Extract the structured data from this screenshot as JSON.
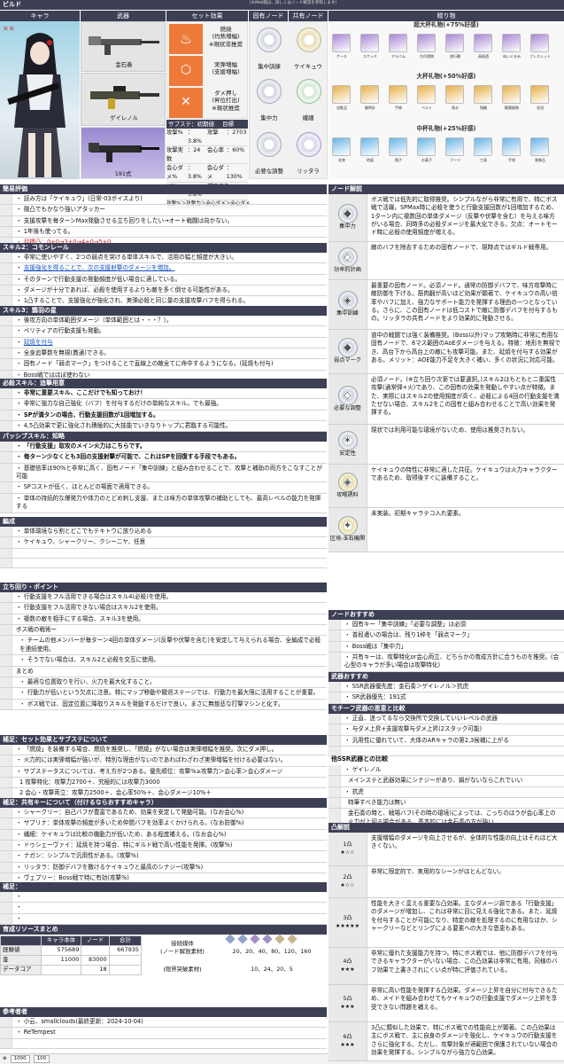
{
  "title_bar": "ビルド",
  "note_top": "(※Web版は、詳しくはノード解説を参照します)",
  "headers": {
    "chara": "キャラ",
    "weapon": "武器",
    "set": "セット効果",
    "fixed_node": "固有ノード",
    "shared_node": "共有ノード",
    "gifts": "贈り物"
  },
  "weapons": [
    {
      "name": "金石奏"
    },
    {
      "name": "ゲイレノル"
    },
    {
      "name": "191式"
    }
  ],
  "sets": [
    {
      "name": "燃焼",
      "sub": "(灼熱増幅)",
      "note": "※現状非推奨"
    },
    {
      "name": "実弾増幅",
      "sub": "(支援増幅)"
    },
    {
      "name": "ダメ押し",
      "sub": "(昇位打出)",
      "note": "※現状推奨"
    }
  ],
  "substats": {
    "title": "サブステ：初期値",
    "target": "目標",
    "rows": [
      [
        "攻撃%",
        "：3.8%",
        "攻撃",
        "：2703"
      ],
      [
        "攻撃実数",
        "：24",
        "会心率",
        "：60%"
      ],
      [
        "会心ダメ%",
        "：3.8%",
        "会心ダメ",
        "：130%"
      ],
      [
        "HP%",
        "：3.8%",
        "補足あり",
        ""
      ]
    ],
    "priority": "攻撃%＞攻撃力＞会心ダメ＞会心ダメ"
  },
  "nodes_top": [
    {
      "left": "集中訓練",
      "right": "ケイキュウ"
    },
    {
      "left": "集中力",
      "right": "繊細"
    },
    {
      "left": "必要な調整",
      "right": "リッタラ"
    }
  ],
  "gifts": {
    "super": "超大杯礼物(+75%好感)",
    "big": "大杯礼物(+50%好感)",
    "mid": "中杯礼物(+25%好感)",
    "super_items": [
      "ケーキ",
      "スケッチ",
      "アルバム",
      "古代遺物",
      "旅行鞄",
      "高級酒",
      "ぬいぐるみ",
      "ブレスレット"
    ],
    "big_items": [
      "化粧品",
      "腕時計",
      "手帳",
      "ベルト",
      "香水",
      "指輪",
      "観葉植物",
      "花冠"
    ],
    "mid_items": [
      "花束",
      "地図",
      "帽子",
      "お菓子",
      "ブーツ",
      "工具",
      "手袋",
      "装飾品"
    ]
  },
  "eval": {
    "title": "簡易評価",
    "lines": [
      "読み方は「ケイキュウ」(日常-03ボイスより)",
      "微凸でもかなり強いアタッカー",
      "支援攻撃を毎ターンMax発動させる立ち回りをしたい→オート戦闘は向かない。",
      "1年後も使ってる。",
      "目標凸：0+0→3+0→4+0→5+0"
    ]
  },
  "skill2": {
    "title": "スキル2：コモンレール",
    "lines": [
      "非常に使いやすく、2つの弱点を突ける単体スキルで、活用の幅と頻度が大きい。",
      "支援強化を得ることで、次の支援射撃のダメージを増加。",
      "そのターンで行動支援の発動頻度が低い場合に適している。",
      "ダメージが十分であれば、必殺を使用するよりも敵を多く倒せる可能性がある。",
      "1凸することで、支援強化が強化され、実弾必殺と同じ量の支援攻撃バフを得られる。"
    ]
  },
  "skill3": {
    "title": "スキル3：鵲羽の星",
    "lines": [
      "後攻方向の単体範囲ダメージ（単体範囲とは・・・？）。",
      "ベリティアの行動支援も発動。",
      "延焼を付与",
      "全身追撃数を無視(貫通)できる。",
      "固有ノード「弱点マーク」をつけることで直線上の敵全てに命中するようになる。(延焼も付与)",
      "Boss戦ではほぼ使わない"
    ]
  },
  "ult": {
    "title": "必殺スキル：追撃用意",
    "lines": [
      "非常に重要スキル、ここだけでも知っておけ！",
      "非常に強力な自己強化（バフ）を付与するだけの単純なスキル。でも最強。",
      "SPが満タンの場合、行動支援回数が1回増加する。",
      "4,5凸効果で更に強化され積極的に大技能でいきなりトップに君臨する可能性。"
    ]
  },
  "passive": {
    "title": "パッシブスキル：知略",
    "lines": [
      "「行動支援」取攻のメイン火力はこちらです。",
      "毎ターン少なくとも3回の支援射撃が可能で、これはSPを回復する手段でもある。",
      "基礎倍率は90%と非常に高く、固有ノード「集中訓練」と組み合わせることで、攻撃と補助の両方をこなすことが可能",
      "SPコストが低く、ほとんどの場面で適用できる。",
      "単体の持続的な爆発力や体力のとどめ刺し支援、または味方の単体攻撃の補助としても、最高レベルの能力を発揮する"
    ]
  },
  "team": {
    "title": "編成",
    "lines": [
      "単体環境なら割とどこでもテキトウに放り込める",
      "ケイキュウ、シャークリー、クシーニヤ、任意"
    ]
  },
  "playstyle": {
    "title": "立ち回り・ポイント",
    "lines": [
      "行動支援をフル活用できる場合はスキル4(必殺)を使用。",
      "行動支援をフル活用できない場合はスキル2を使用。",
      "複数の敵を相手にする場合、スキル3を使用。",
      "ボス戦の戦術ー",
      "チームの他メンバーが毎ターン4回の単体ダメージ(反撃や伏撃を含む)を安定して与えられる場合、全編成で必殺を連続使用。",
      "そうでない場合は、スキル2と必殺を交互に使用。",
      "まとめ",
      "最適な位置取りを行い、火力を最大化すること。",
      "行動力が低いという欠点に注意。特にマップ移動や撤退ステージでは、行動力を最大限に活用することが重要。",
      "ボス戦では、固定位置に降取りスキルを発動するだけで良い。まさに無慈悲な打撃マシンと化す。"
    ]
  },
  "setnote": {
    "title": "補足：セット効果とサブステについて",
    "lines": [
      "「燃焼」を装備する場合、燃焼を推奨し、「燃焼」がない場合は実弾増幅を推奨。次にダメ押し。",
      "火力的には実弾増幅が強いが、特別な理由がないのであればわざわざ実弾増幅を付ける必要はない。",
      "サブステータスについては、考え方が2つある。優先順位：攻撃%≥攻撃力＞会心率＞会心ダメージ",
      "1 攻撃特化：攻撃力2700＋、究極的には攻撃力3000",
      "2 会心・攻撃両立：攻撃力2500＋、会心率50%＋、会心ダメージ10%＋"
    ]
  },
  "shared": {
    "title": "補足：共有キーについて（付けるならおすすめキャラ）",
    "lines": [
      "シャークリー：自己バフが豊富であるため、効果を安定して発動可能。(なお会心%)",
      "サブリナ：単体攻撃の頻度が多いため仲間バフを効率よくかけられる。(なお防御%)",
      "繊細：ケイキュウは比較の機動力が低いため、ある程度補える。(なお会心%)",
      "ドゥシェーヴァイ：延焼を持つ場合、特にギルド戦で高い性能を発揮。(攻撃%)",
      "ナガン：シンプルで汎用性がある。(攻撃%)",
      "リッタラ：防御デバフを撒けるケイキュウと最高のシナジー(攻撃%)",
      "ヴェプリー：Boss戦で特に有効(攻撃%)"
    ]
  },
  "note_empty": {
    "title": "補足："
  },
  "resources": {
    "title": "育成リソースまとめ",
    "headers": [
      "",
      "キャラ本体",
      "ノード",
      "合計"
    ],
    "rows": [
      [
        "経験値",
        "575689",
        "",
        "667935"
      ],
      [
        "金",
        "11000",
        "83000",
        ""
      ],
      [
        "データコア",
        "",
        "18",
        ""
      ]
    ],
    "mat_label": "接続媒体\n(ノード解放素材)",
    "mat_values": "20、20、40、80、120、160",
    "limit_label": "(限界突破素材)",
    "limit_values": "10、24、20、5"
  },
  "refs": {
    "title": "参考者者",
    "lines": [
      "小云、smallclouds(最終更新：2024-10-04)",
      "ReTempest"
    ]
  },
  "node_guide": {
    "title": "ノード解説",
    "items": [
      {
        "name": "集中力",
        "text": "ボス戦では低先的に取得推奨。シンプルながら非常に有用で、特にボス戦で活躍。SPMax時に必殺を使うと行動支援回数が1回増加するため、1ターン内に複数回の単体ダメージ（反撃や伏撃を含む）を与える味方がいる場合、同時多の必殺ダメージを最大化できる。欠点：オートモード時に必殺の使用頻度が増える。"
      },
      {
        "name": "効率的計画",
        "text": "敵のバフを除去するための固有ノードで、現時点ではギルド戦専用。"
      },
      {
        "name": "集中訓練",
        "text": "最重要の固有ノード。必須ノード。通常の防御デバフで、味方攻撃時に敵防御を下げる。筋肉翻が高いほど効果が顕著で、ケイキュウの高い倍率やバフに加え、強力なサポート能力を発揮する理由の一つとなっている。さらに、この固有ノードは低コストで敵に防御デバフを付与するもの。リッタラの共有ノードをより効果的に発動させる。"
      },
      {
        "name": "弱点マーク",
        "text": "道中の戦闘では強く装備推奨。(Boss以外)マップ攻略時に非常に有用な固有ノードで、8マス範囲のAoEダメージを与える。特徴：地形を無視でき、高台下から高台上の敵にも攻撃可能。また、延焼を付与する効果がある。メリット：AOE能力不足を大きく補い、多くの状況に対応可能。"
      },
      {
        "name": "必要な調整",
        "text": "必須ノード。(※立ち回り次第では要選択。)スキル2はもともと二重属性攻撃(通常弾+火)であり、この固有の効果を発動しやすい点が特徴。また、実際にはスキル2の使用頻度が高く、必殺による4回の行動支援を満たせない場合、スキル2をこの固有と組み合わせることで高い効果を発揮する。"
      },
      {
        "name": "安定性",
        "text": "現状では利用可能な環境がないため、使用は推奨されない。"
      },
      {
        "name": "攻略誘料",
        "text": "ケイキュウの特性に非常に適した共征。ケイキュウは火力キャラクターであるため、取得後すぐに装備すること。"
      },
      {
        "name": "区境-玉石機関",
        "text": "未実装。初期キャラテコ入れ要素。"
      }
    ]
  },
  "node_rec": {
    "title": "ノードおすすめ",
    "lines": [
      "固有キー「集中訓練」「必要な調整」は必須",
      "普段遣いの場合は、残り1枠を「弱点マーク」",
      "Boss戦は「集中力」",
      "共有キーは、攻撃特化or会心両立、どちらかの育成方針に合うものを推奨。(会心型のキャラが多い場合は攻撃特化)"
    ]
  },
  "weapon_rec": {
    "title": "武器おすすめ",
    "lines": [
      "SSR武器優先度：金石奏＞ゲイレノル＞抗虎",
      "SR武器優先：191式"
    ]
  },
  "motif": {
    "title": "モチーフ武器の恩恵と比較",
    "lines": [
      "正直、迷ってるなら交換所で交換していいレベルの武器",
      "与ダメ上昇+支援攻撃与ダメ上昇(2スタック可能)",
      "汎用性に優れていて、大体のARキャラの第2,3候補に上がる"
    ]
  },
  "other_ssr": {
    "title": "他SSR武器との比較",
    "lines": [
      "ゲイレノル",
      "メインステと武器効果にシナジーがあり、鍋がないならこれでいい",
      "抗虎",
      "特筆すべき能力は無い",
      "金石奏の時と、戦場バフ(その時の環境)によっては、こっちのほうが会心率上の火力が上回る場合がある。基本的には金石奏の方が強い"
    ]
  },
  "constellation": {
    "title": "凸解説",
    "items": [
      {
        "lv": "1凸",
        "stars": "★☆☆",
        "text": "支援増幅のダメージを向上させるが、全体的な性能の向上はそれほど大きくない。"
      },
      {
        "lv": "2凸",
        "stars": "★☆☆",
        "text": "非常に限定的で、実用的なシーンがほとんどない。"
      },
      {
        "lv": "3凸",
        "stars": "★★★★★",
        "text": "性能を大きく変える重要な凸効果。主なダメージ源である「行動支援」のダメージが増加し、これは非常に目に見える強化である。また、延焼を付与することが可能になり、特定の敵を処理するのに有用なほか、シャークリーなどとリングによる要素への大きな恩恵もある。"
      },
      {
        "lv": "4凸",
        "stars": "★★★",
        "text": "非常に優れた支援能力を持つ。特にボス戦では、他に防御デバフを付与できるキャラクターがいない場合、この凸効果は非常に有用。同様のバフ効果で上書きされにくい点が特に評価されている。"
      },
      {
        "lv": "5凸",
        "stars": "★★★",
        "text": "非常に高い性能を発揮する凸効果。ダメージ上昇を自分に付与できるため、メイドを組み合わせてもケイキュウの行動支援でダメージ上昇を享受できない問題を補える。"
      },
      {
        "lv": "6凸",
        "stars": "★★★",
        "text": "3凸に類似した効果で、特にボス戦での性能向上が顕著。この凸効果は主にボス戦で、主に自身のダメージを強化し、ケイキュウの行動支援をさらに強化する。ただし、攻撃対象が適範囲で保護されていない場合の効果を発揮する。シンプルながら強力な凸効果。"
      }
    ]
  },
  "footer": {
    "zoom": "1000",
    "page": "100"
  }
}
